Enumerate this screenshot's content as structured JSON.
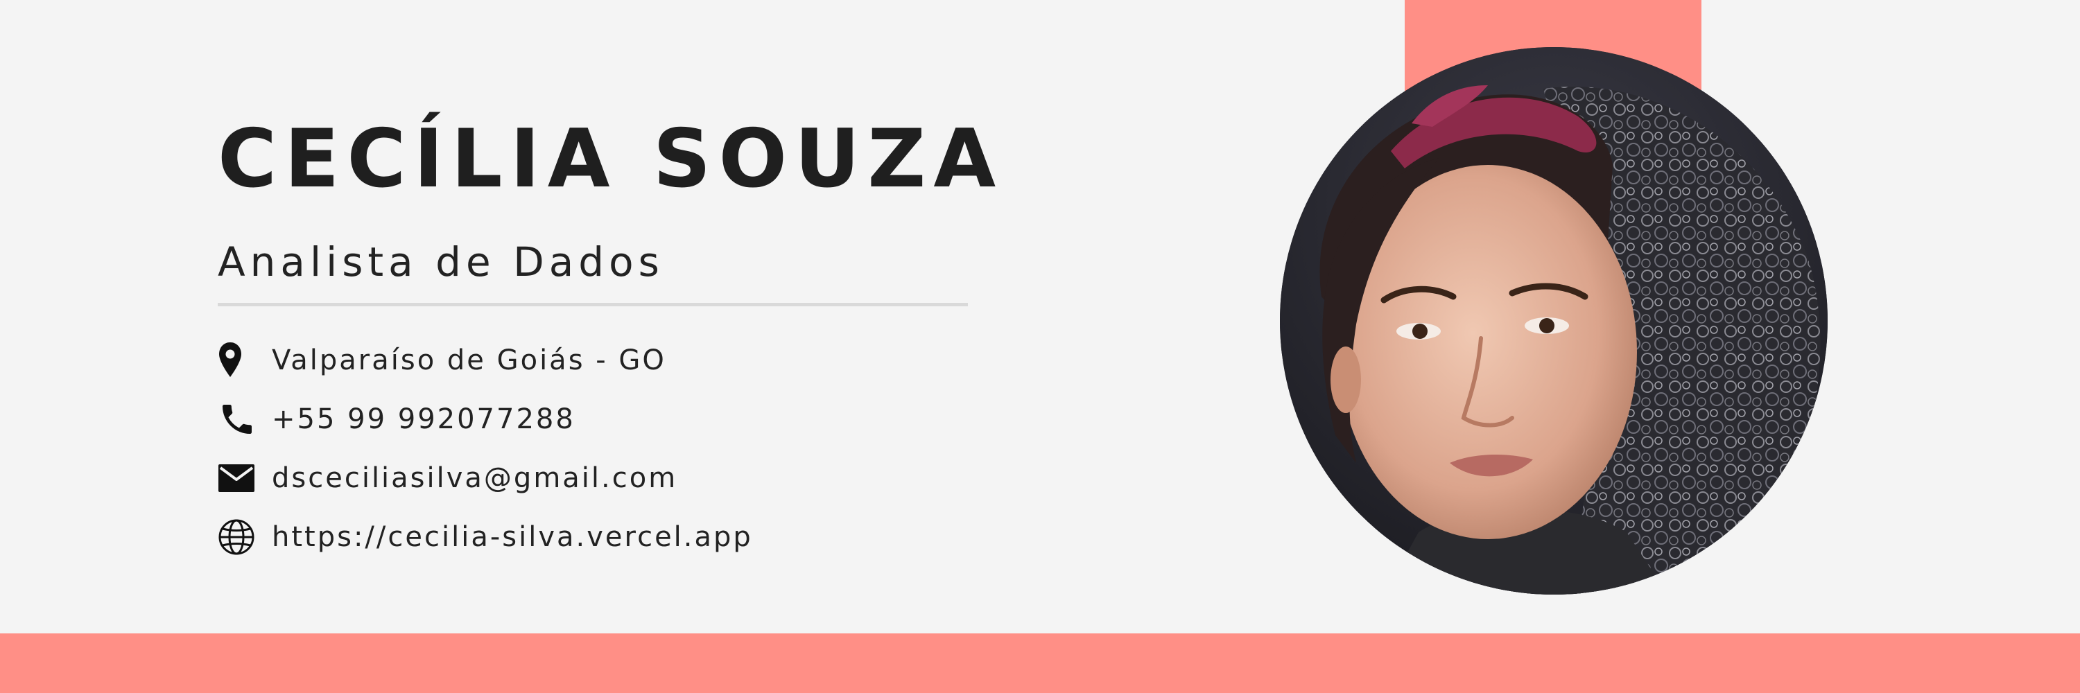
{
  "profile": {
    "name": "CECÍLIA SOUZA",
    "title": "Analista de Dados"
  },
  "contacts": [
    {
      "icon": "location-pin-icon",
      "text": "Valparaíso de Goiás - GO"
    },
    {
      "icon": "phone-icon",
      "text": "+55 99 992077288"
    },
    {
      "icon": "envelope-icon",
      "text": "dsceciliasilva@gmail.com"
    },
    {
      "icon": "globe-icon",
      "text": "https://cecilia-silva.vercel.app"
    }
  ],
  "colors": {
    "background": "#f4f4f4",
    "accent": "#ff8f86",
    "text": "#1f1f1f",
    "divider": "#d9d9d9"
  }
}
